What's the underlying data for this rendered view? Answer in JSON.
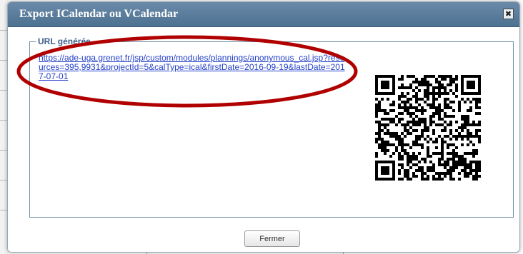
{
  "dialog": {
    "title": "Export ICalendar ou VCalendar",
    "close_icon": "✖"
  },
  "fieldset": {
    "legend": "URL générée",
    "url": "https://ade-uga.grenet.fr/jsp/custom/modules/plannings/anonymous_cal.jsp?resources=395,9931&projectId=5&calType=ical&firstDate=2016-09-19&lastDate=2017-07-01"
  },
  "footer": {
    "close_button_label": "Fermer"
  },
  "annotation": {
    "ellipse_color": "#b00000"
  }
}
